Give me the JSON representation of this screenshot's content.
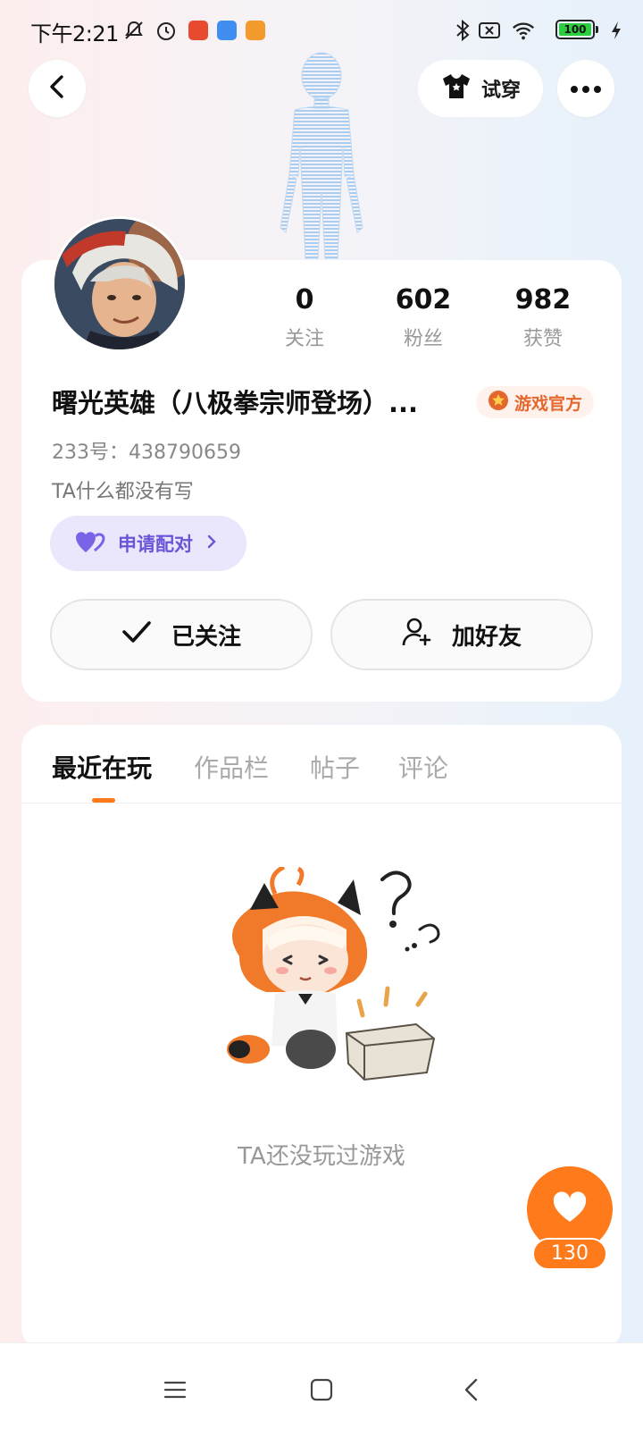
{
  "status_bar": {
    "time": "下午2:21",
    "battery": "100",
    "icons": [
      "mute-icon",
      "alarm-icon",
      "app-icon-red",
      "app-icon-blue",
      "app-icon-orange",
      "bluetooth-icon",
      "sim-off-icon",
      "wifi-icon",
      "battery-icon",
      "charging-icon"
    ]
  },
  "header": {
    "back_icon": "chevron-left-icon",
    "tryon_label": "试穿",
    "more_icon": "more-dots-icon"
  },
  "profile": {
    "stats": [
      {
        "value": "0",
        "label": "关注"
      },
      {
        "value": "602",
        "label": "粉丝"
      },
      {
        "value": "982",
        "label": "获赞"
      }
    ],
    "username": "曙光英雄（八极拳宗师登场）...",
    "badge": "游戏官方",
    "uid": "233号：438790659",
    "bio": "TA什么都没有写",
    "pair_label": "申请配对",
    "follow_label": "已关注",
    "add_friend_label": "加好友"
  },
  "tabs": [
    {
      "label": "最近在玩",
      "active": true
    },
    {
      "label": "作品栏",
      "active": false
    },
    {
      "label": "帖子",
      "active": false
    },
    {
      "label": "评论",
      "active": false
    }
  ],
  "empty_state": {
    "message": "TA还没玩过游戏"
  },
  "like": {
    "count": "130"
  },
  "colors": {
    "accent": "#ff7a1a",
    "pair_bg": "#eae6fb",
    "pair_text": "#6a55d6",
    "badge_text": "#e4672e"
  }
}
